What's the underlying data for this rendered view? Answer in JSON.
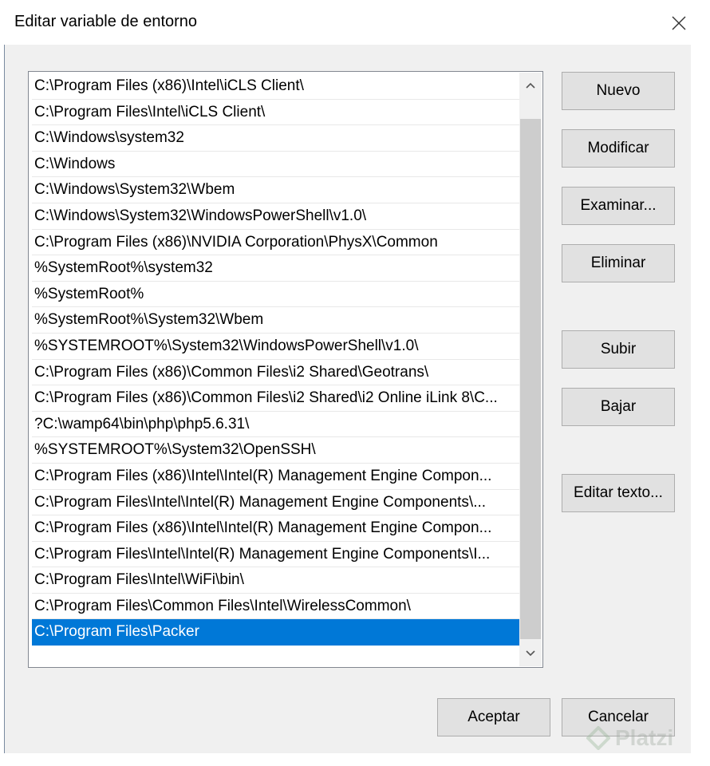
{
  "window": {
    "title": "Editar variable de entorno",
    "close_icon": "close-icon"
  },
  "list": {
    "items": [
      "C:\\Program Files (x86)\\Intel\\iCLS Client\\",
      "C:\\Program Files\\Intel\\iCLS Client\\",
      "C:\\Windows\\system32",
      "C:\\Windows",
      "C:\\Windows\\System32\\Wbem",
      "C:\\Windows\\System32\\WindowsPowerShell\\v1.0\\",
      "C:\\Program Files (x86)\\NVIDIA Corporation\\PhysX\\Common",
      "%SystemRoot%\\system32",
      "%SystemRoot%",
      "%SystemRoot%\\System32\\Wbem",
      "%SYSTEMROOT%\\System32\\WindowsPowerShell\\v1.0\\",
      "C:\\Program Files (x86)\\Common Files\\i2 Shared\\Geotrans\\",
      "C:\\Program Files (x86)\\Common Files\\i2 Shared\\i2 Online iLink 8\\C...",
      "?C:\\wamp64\\bin\\php\\php5.6.31\\",
      "%SYSTEMROOT%\\System32\\OpenSSH\\",
      "C:\\Program Files (x86)\\Intel\\Intel(R) Management Engine Compon...",
      "C:\\Program Files\\Intel\\Intel(R) Management Engine Components\\...",
      "C:\\Program Files (x86)\\Intel\\Intel(R) Management Engine Compon...",
      "C:\\Program Files\\Intel\\Intel(R) Management Engine Components\\I...",
      "C:\\Program Files\\Intel\\WiFi\\bin\\",
      "C:\\Program Files\\Common Files\\Intel\\WirelessCommon\\",
      "C:\\Program Files\\Packer"
    ],
    "selected_index": 21
  },
  "buttons": {
    "nuevo": "Nuevo",
    "modificar": "Modificar",
    "examinar": "Examinar...",
    "eliminar": "Eliminar",
    "subir": "Subir",
    "bajar": "Bajar",
    "editar_texto": "Editar texto...",
    "aceptar": "Aceptar",
    "cancelar": "Cancelar"
  },
  "watermark": {
    "text": "Platzi"
  },
  "colors": {
    "selection": "#0078d7",
    "button_bg": "#e1e1e1",
    "dialog_bg": "#f0f0f0"
  }
}
